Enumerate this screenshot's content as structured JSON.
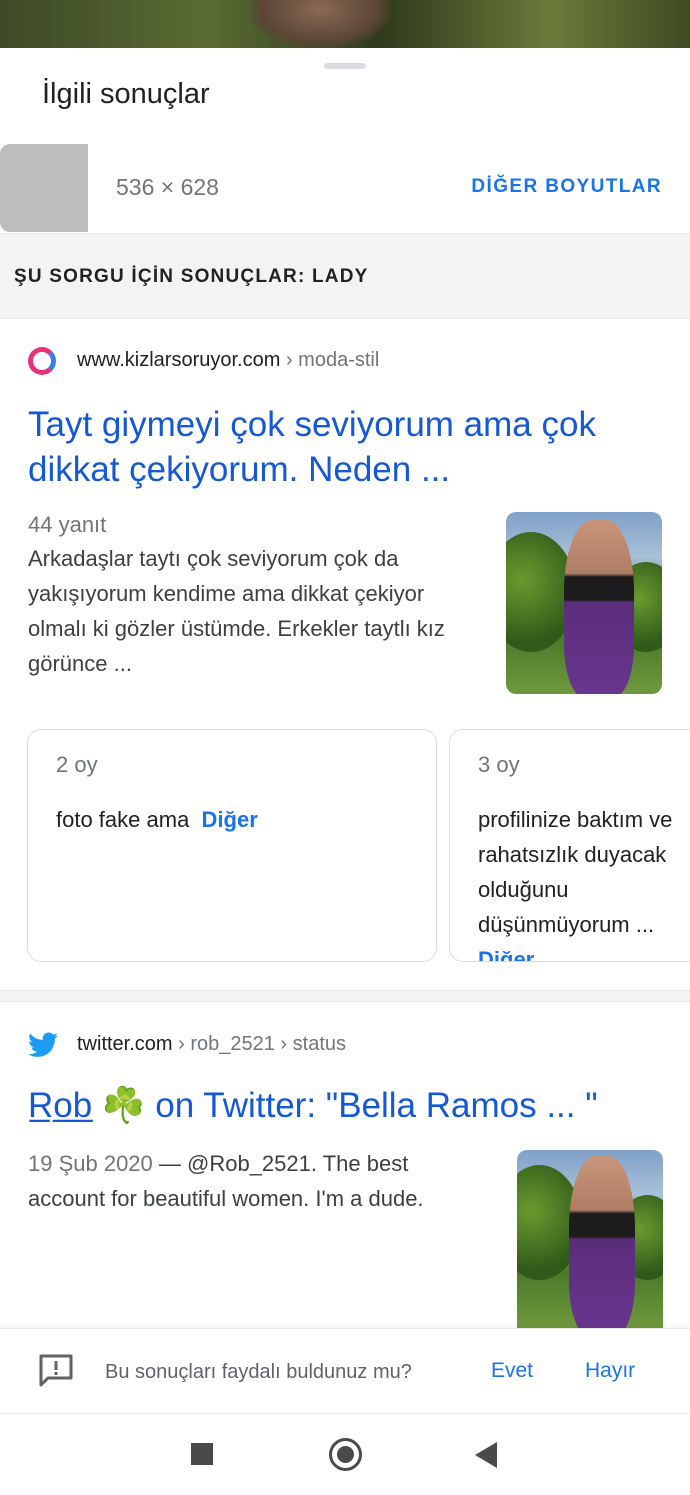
{
  "related": {
    "title": "İlgili sonuçlar",
    "size_text": "536 × 628",
    "more_sizes": "DİĞER BOYUTLAR"
  },
  "query": {
    "label": "ŞU SORGU İÇİN SONUÇLAR: LADY"
  },
  "results": [
    {
      "domain": "www.kizlarsoruyor.com",
      "path": " › moda-stil",
      "favicon": "kizlarsoruyor-logo-icon",
      "title": "Tayt giymeyi çok seviyorum ama çok dikkat çekiyorum. Neden ...",
      "meta": "44 yanıt",
      "snippet": "Arkadaşlar taytı çok seviyorum çok da yakışıyorum kendime ama dikkat çekiyor olmalı ki gözler üstümde. Erkekler taytlı kız görünce ...",
      "comments": [
        {
          "votes": "2 oy",
          "text": "foto fake ama",
          "more": "Diğer"
        },
        {
          "votes": "3 oy",
          "text": "profilinize baktım ve rahatsızlık duyacak olduğunu düşünmüyorum ...",
          "more": "Diğer"
        }
      ]
    },
    {
      "domain": "twitter.com",
      "path": " › rob_2521 › status",
      "favicon": "twitter-bird-icon",
      "title": "R̲o̲b̲ ☘️ on Twitter: \"Bella Ramos ... \"",
      "date": "19 Şub 2020",
      "snippet_rest": " — @Rob_2521. The best account for beautiful women. I'm a dude."
    }
  ],
  "feedback": {
    "question": "Bu sonuçları faydalı buldunuz mu?",
    "yes": "Evet",
    "no": "Hayır",
    "icon": "feedback-icon"
  },
  "navbar": {
    "recents": "square-icon",
    "home": "home-circle-icon",
    "back": "back-triangle-icon"
  },
  "colors": {
    "link": "#1558d6",
    "accent": "#1a73e8",
    "muted": "#70757a"
  }
}
